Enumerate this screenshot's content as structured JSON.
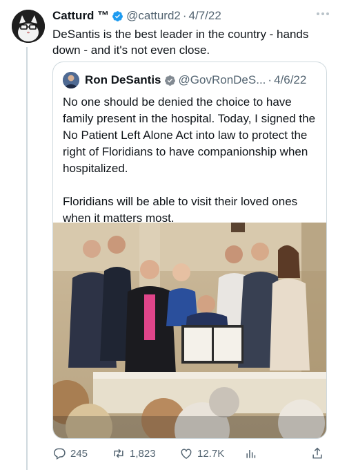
{
  "tweet": {
    "author_name": "Catturd ™",
    "handle": "@catturd2",
    "separator": "·",
    "date": "4/7/22",
    "text": "DeSantis is the best leader in the country - hands down - and it's not even close."
  },
  "quoted": {
    "author_name": "Ron DeSantis",
    "handle": "@GovRonDeS...",
    "separator": "·",
    "date": "4/6/22",
    "text": "No one should be denied the choice to have family present in the hospital. Today, I signed the No Patient Left Alone Act into law to protect the right of Floridians to have companionship when hospitalized.\n\nFloridians will be able to visit their loved ones when it matters most."
  },
  "actions": {
    "replies": "245",
    "retweets": "1,823",
    "likes": "12.7K"
  },
  "colors": {
    "verified": "#1d9bf0",
    "muted": "#536471",
    "border": "#cfd9de"
  }
}
